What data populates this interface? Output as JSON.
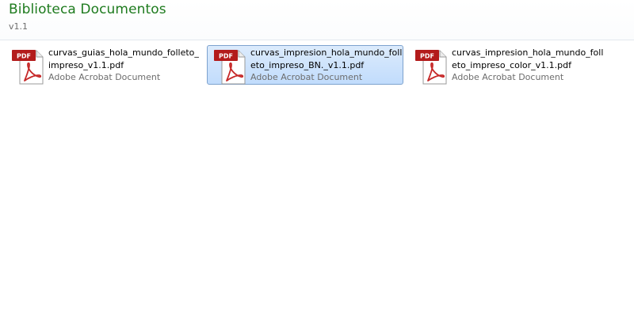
{
  "header": {
    "title": "Biblioteca Documentos",
    "version": "v1.1"
  },
  "files": [
    {
      "name": "curvas_guias_hola_mundo_folleto_impreso_v1.1.pdf",
      "type": "Adobe Acrobat Document",
      "icon": "pdf-file-icon",
      "icon_badge": "PDF",
      "selected": false
    },
    {
      "name": "curvas_impresion_hola_mundo_folleto_impreso_BN._v1.1.pdf",
      "type": "Adobe Acrobat Document",
      "icon": "pdf-file-icon",
      "icon_badge": "PDF",
      "selected": true
    },
    {
      "name": "curvas_impresion_hola_mundo_folleto_impreso_color_v1.1.pdf",
      "type": "Adobe Acrobat Document",
      "icon": "pdf-file-icon",
      "icon_badge": "PDF",
      "selected": false
    }
  ],
  "colors": {
    "title": "#1e7b1e",
    "selection_bg": "#c9e0fc",
    "selection_border": "#7da2ce",
    "pdf_badge": "#b31b1b"
  }
}
